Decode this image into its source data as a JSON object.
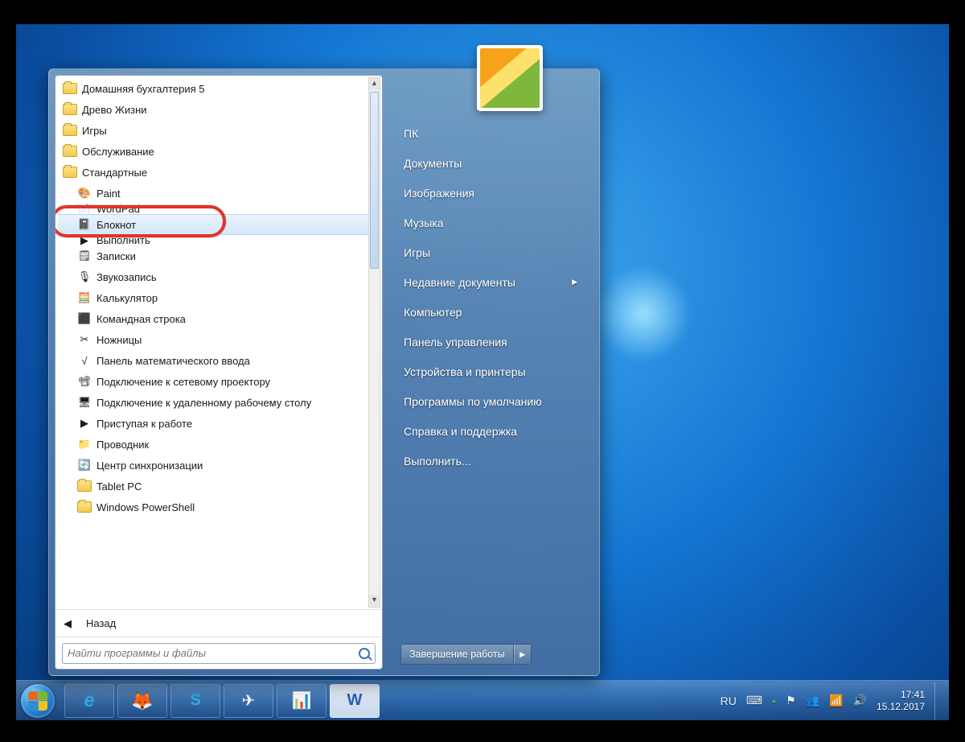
{
  "startmenu": {
    "programs": {
      "folders_top": [
        "Домашняя бухгалтерия 5",
        "Древо Жизни",
        "Игры",
        "Обслуживание",
        "Стандартные"
      ],
      "apps": [
        {
          "label": "Paint",
          "icon": "🎨"
        },
        {
          "label": "WordPad",
          "icon": "📄",
          "clipped": true
        },
        {
          "label": "Блокнот",
          "icon": "📓",
          "highlighted": true,
          "callout": true
        },
        {
          "label": "Выполнить",
          "icon": "▶",
          "clipped": true
        },
        {
          "label": "Записки",
          "icon": "🗒"
        },
        {
          "label": "Звукозапись",
          "icon": "🎙"
        },
        {
          "label": "Калькулятор",
          "icon": "🧮"
        },
        {
          "label": "Командная строка",
          "icon": "⬛"
        },
        {
          "label": "Ножницы",
          "icon": "✂"
        },
        {
          "label": "Панель математического ввода",
          "icon": "√"
        },
        {
          "label": "Подключение к сетевому проектору",
          "icon": "📽"
        },
        {
          "label": "Подключение к удаленному рабочему столу",
          "icon": "🖥"
        },
        {
          "label": "Приступая к работе",
          "icon": "▶"
        },
        {
          "label": "Проводник",
          "icon": "📁"
        },
        {
          "label": "Центр синхронизации",
          "icon": "🔄"
        }
      ],
      "folders_bottom": [
        "Tablet PC",
        "Windows PowerShell"
      ]
    },
    "back_label": "Назад",
    "search_placeholder": "Найти программы и файлы",
    "right_links": [
      {
        "label": "ПК"
      },
      {
        "label": "Документы"
      },
      {
        "label": "Изображения"
      },
      {
        "label": "Музыка"
      },
      {
        "label": "Игры"
      },
      {
        "label": "Недавние документы",
        "submenu": true
      },
      {
        "label": "Компьютер"
      },
      {
        "label": "Панель управления"
      },
      {
        "label": "Устройства и принтеры"
      },
      {
        "label": "Программы по умолчанию"
      },
      {
        "label": "Справка и поддержка"
      },
      {
        "label": "Выполнить..."
      }
    ],
    "shutdown_label": "Завершение работы"
  },
  "taskbar": {
    "apps": [
      {
        "name": "internet-explorer",
        "glyph": "e"
      },
      {
        "name": "firefox",
        "glyph": "🦊"
      },
      {
        "name": "skype",
        "glyph": "S"
      },
      {
        "name": "telegram",
        "glyph": "✈"
      },
      {
        "name": "task-manager",
        "glyph": "📊"
      },
      {
        "name": "word",
        "glyph": "W"
      }
    ],
    "lang": "RU",
    "time": "17:41",
    "date": "15.12.2017"
  }
}
